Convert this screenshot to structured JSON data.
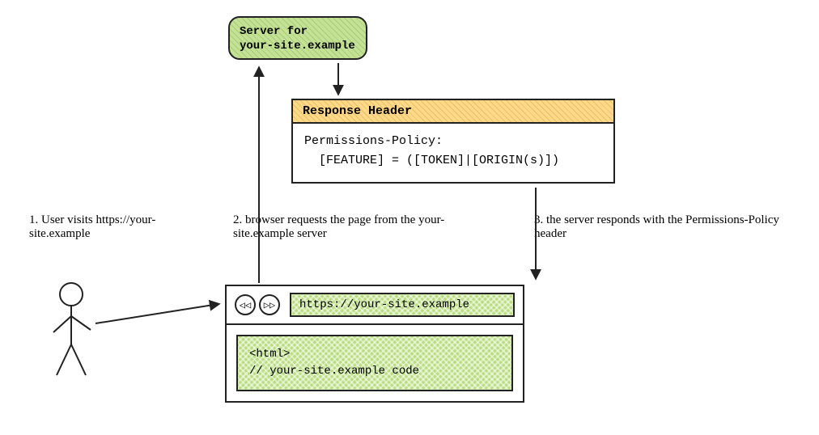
{
  "server": {
    "line1": "Server for",
    "line2": "your-site.example"
  },
  "response_header": {
    "title": "Response Header",
    "line1": "Permissions-Policy:",
    "line2": "  [FEATURE] = ([TOKEN]|[ORIGIN(s)])"
  },
  "captions": {
    "c1": "1. User visits https://your-site.example",
    "c2": "2. browser requests the page from the your-site.example server",
    "c3": "3. the server responds with the Permissions-Policy header"
  },
  "browser": {
    "url": "https://your-site.example",
    "code_line1": "<html>",
    "code_line2": "// your-site.example code",
    "back_icon": "◁◁",
    "fwd_icon": "▷▷"
  }
}
